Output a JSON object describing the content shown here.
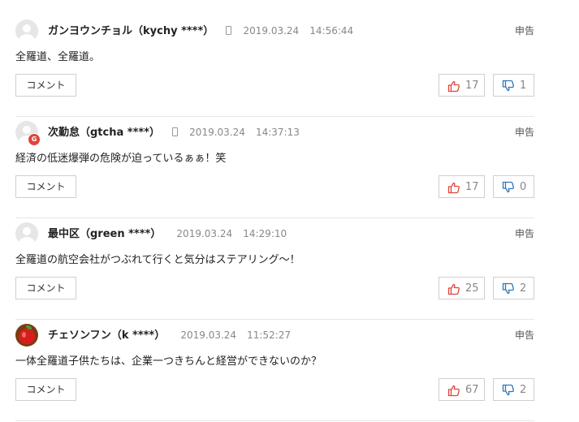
{
  "comments": [
    {
      "author": "ガンヨウンチョル（kychy ****）",
      "has_phone_icon": true,
      "date": "2019.03.24",
      "time": "14:56:44",
      "report": "申告",
      "text": "全羅道、全羅道。",
      "reply_label": "コメント",
      "likes": "17",
      "dislikes": "1"
    },
    {
      "author": "次勤怠（gtcha ****）",
      "has_phone_icon": true,
      "date": "2019.03.24",
      "time": "14:37:13",
      "report": "申告",
      "text": "経済の低迷爆弾の危険が迫っているぁぁ！笑",
      "reply_label": "コメント",
      "likes": "17",
      "dislikes": "0"
    },
    {
      "author": "最中区（green ****）",
      "has_phone_icon": false,
      "date": "2019.03.24",
      "time": "14:29:10",
      "report": "申告",
      "text": "全羅道の航空会社がつぶれて行くと気分はステアリング〜！",
      "reply_label": "コメント",
      "likes": "25",
      "dislikes": "2"
    },
    {
      "author": "チェソンフン（k ****）",
      "has_phone_icon": false,
      "date": "2019.03.24",
      "time": "11:52:27",
      "report": "申告",
      "text": "一体全羅道子供たちは、企業一つきちんと経営ができないのか？",
      "reply_label": "コメント",
      "likes": "67",
      "dislikes": "2"
    }
  ],
  "icons": {
    "like": "thumbs-up-icon",
    "dislike": "thumbs-down-icon",
    "phone": "mobile-phone-icon",
    "google_badge": "G"
  },
  "colors": {
    "like_icon": "#e0453a",
    "dislike_icon": "#2f76b9",
    "divider": "#e6e6e6",
    "secondary_text": "#888888"
  }
}
